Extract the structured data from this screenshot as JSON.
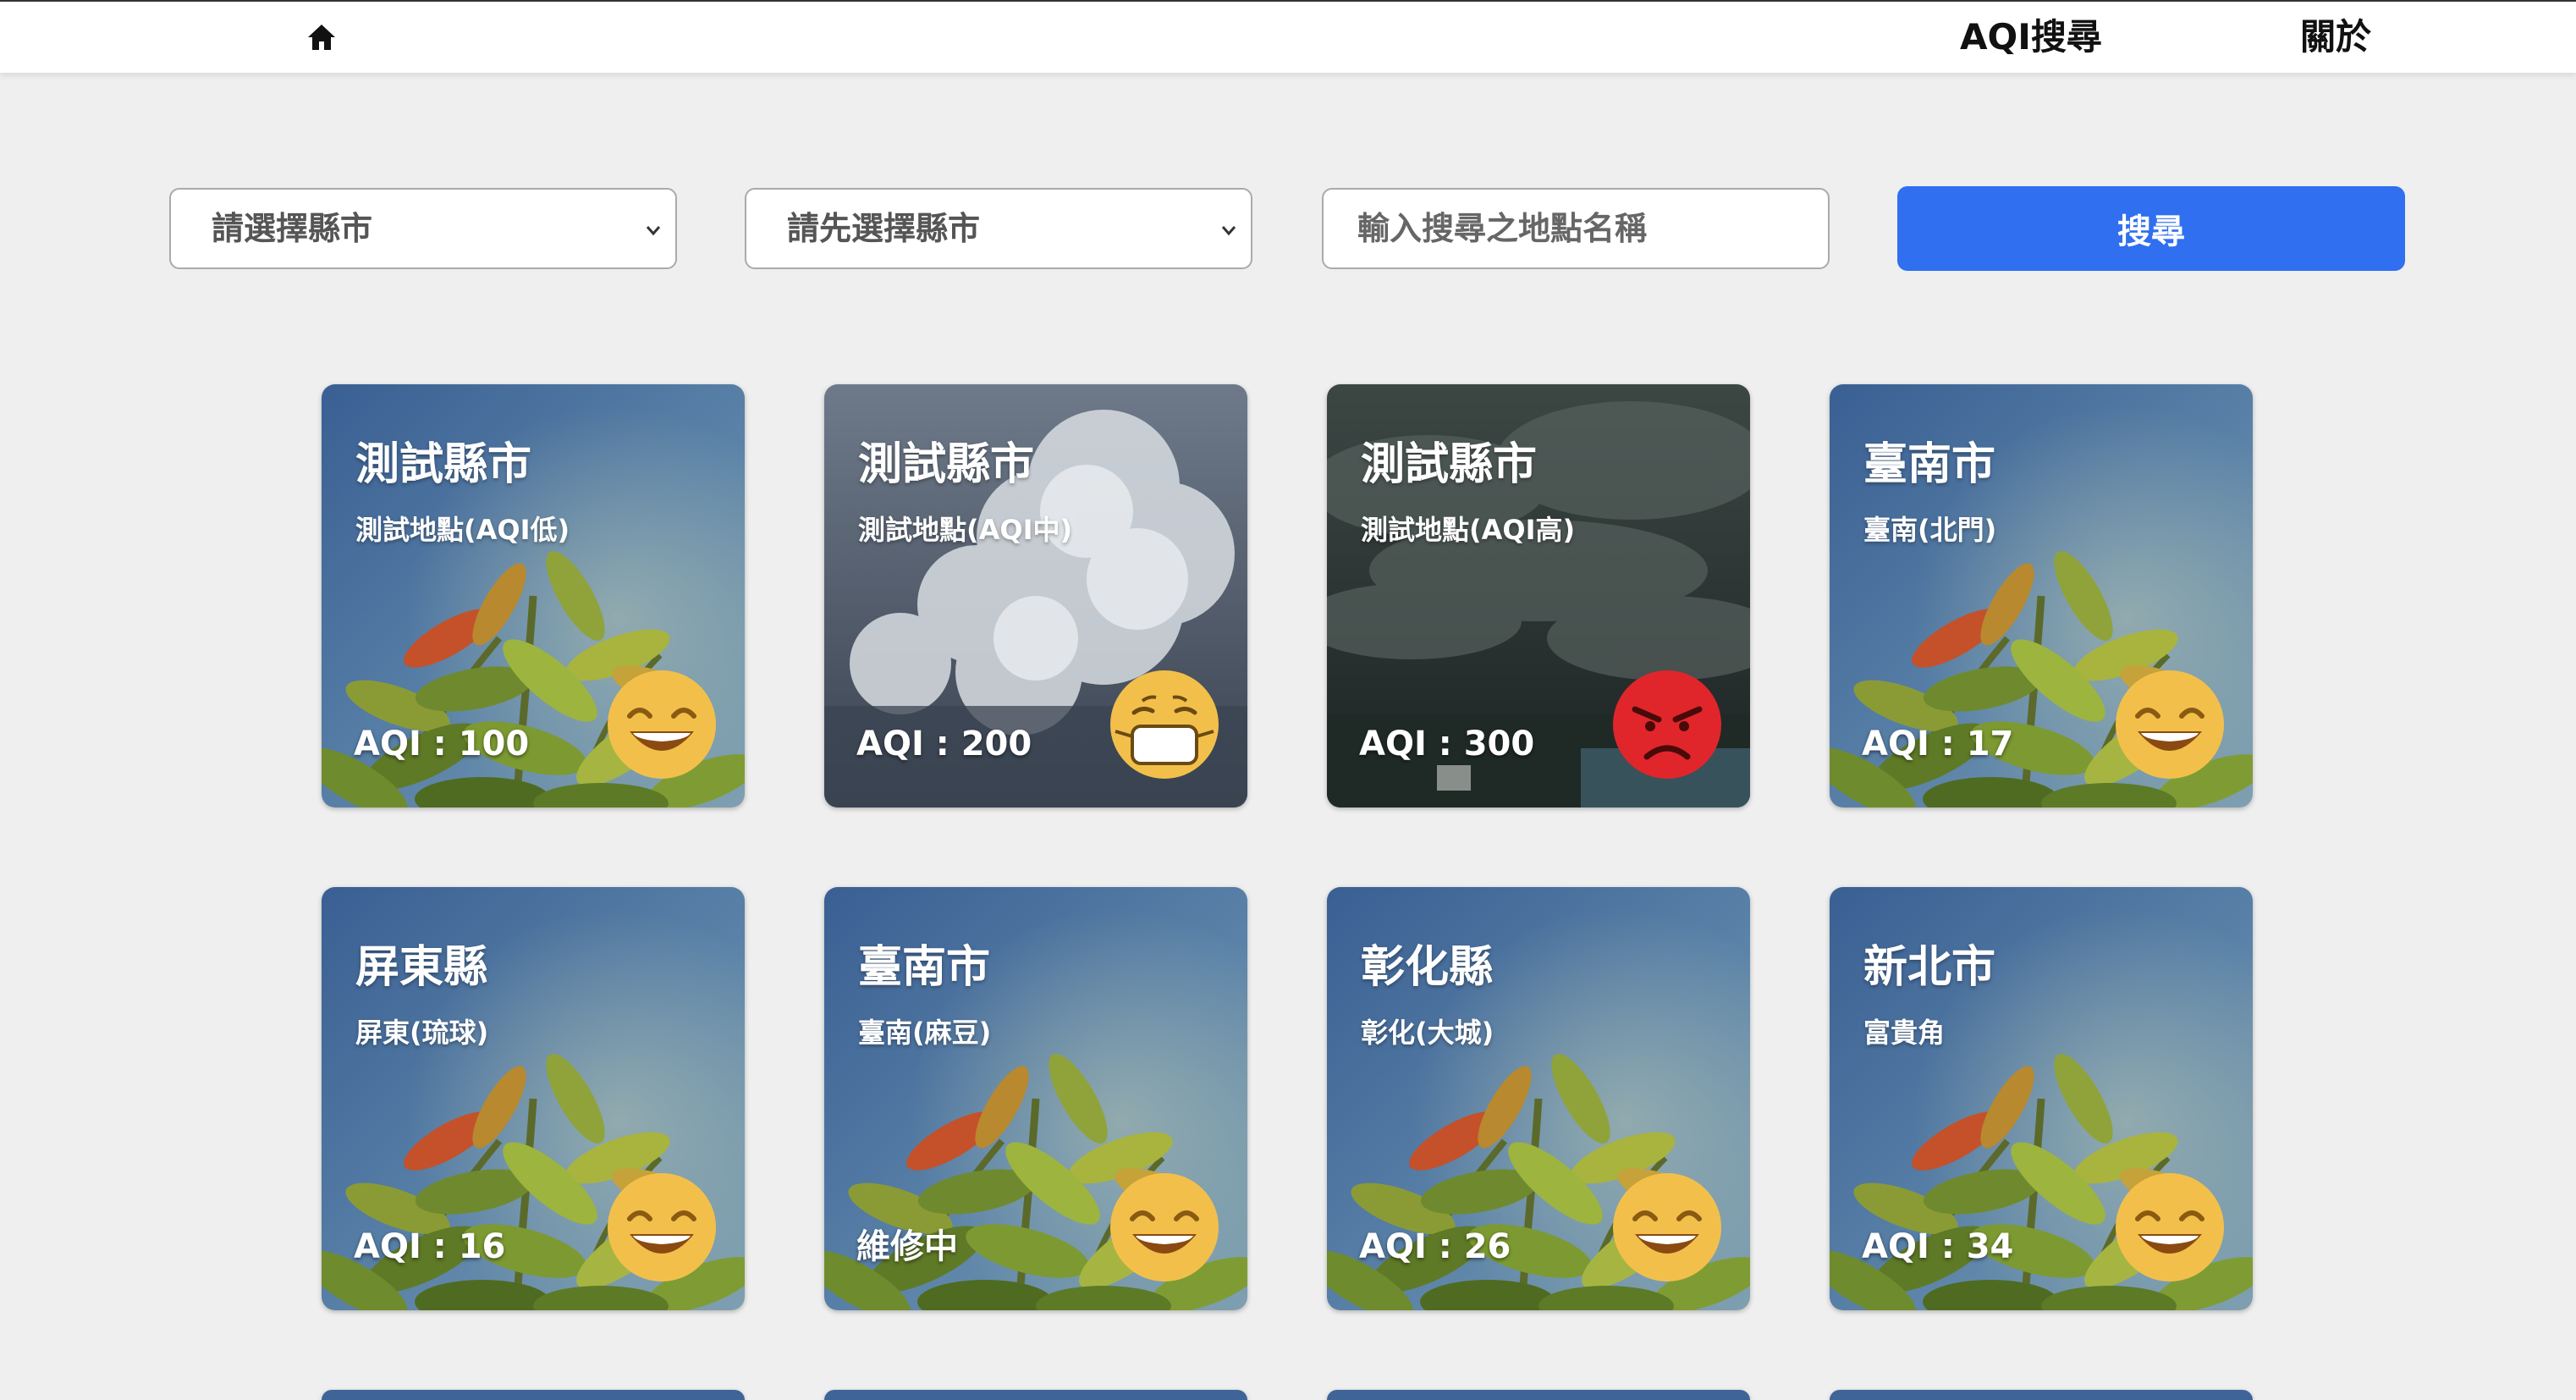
{
  "nav": {
    "home_icon": "home-icon",
    "aqi_search": "AQI搜尋",
    "about": "關於"
  },
  "filters": {
    "county_select": "請選擇縣市",
    "site_select": "請先選擇縣市",
    "search_placeholder": "輸入搜尋之地點名稱",
    "search_button": "搜尋"
  },
  "colors": {
    "primary_button": "#2f6ff0",
    "good_face": "#f2c04a",
    "bad_face": "#e0262b"
  },
  "cards": [
    {
      "city": "測試縣市",
      "site": "測試地點(AQI低)",
      "aqi": "AQI : 100",
      "bg": "plant",
      "face": "grin-face-icon"
    },
    {
      "city": "測試縣市",
      "site": "測試地點(AQI中)",
      "aqi": "AQI : 200",
      "bg": "clouds",
      "face": "mask-face-icon"
    },
    {
      "city": "測試縣市",
      "site": "測試地點(AQI高)",
      "aqi": "AQI : 300",
      "bg": "storm",
      "face": "angry-face-icon"
    },
    {
      "city": "臺南市",
      "site": "臺南(北門)",
      "aqi": "AQI : 17",
      "bg": "plant",
      "face": "grin-face-icon"
    },
    {
      "city": "屏東縣",
      "site": "屏東(琉球)",
      "aqi": "AQI : 16",
      "bg": "plant",
      "face": "grin-face-icon"
    },
    {
      "city": "臺南市",
      "site": "臺南(麻豆)",
      "aqi": "維修中",
      "bg": "plant",
      "face": "grin-face-icon"
    },
    {
      "city": "彰化縣",
      "site": "彰化(大城)",
      "aqi": "AQI : 26",
      "bg": "plant",
      "face": "grin-face-icon"
    },
    {
      "city": "新北市",
      "site": "富貴角",
      "aqi": "AQI : 34",
      "bg": "plant",
      "face": "grin-face-icon"
    }
  ]
}
